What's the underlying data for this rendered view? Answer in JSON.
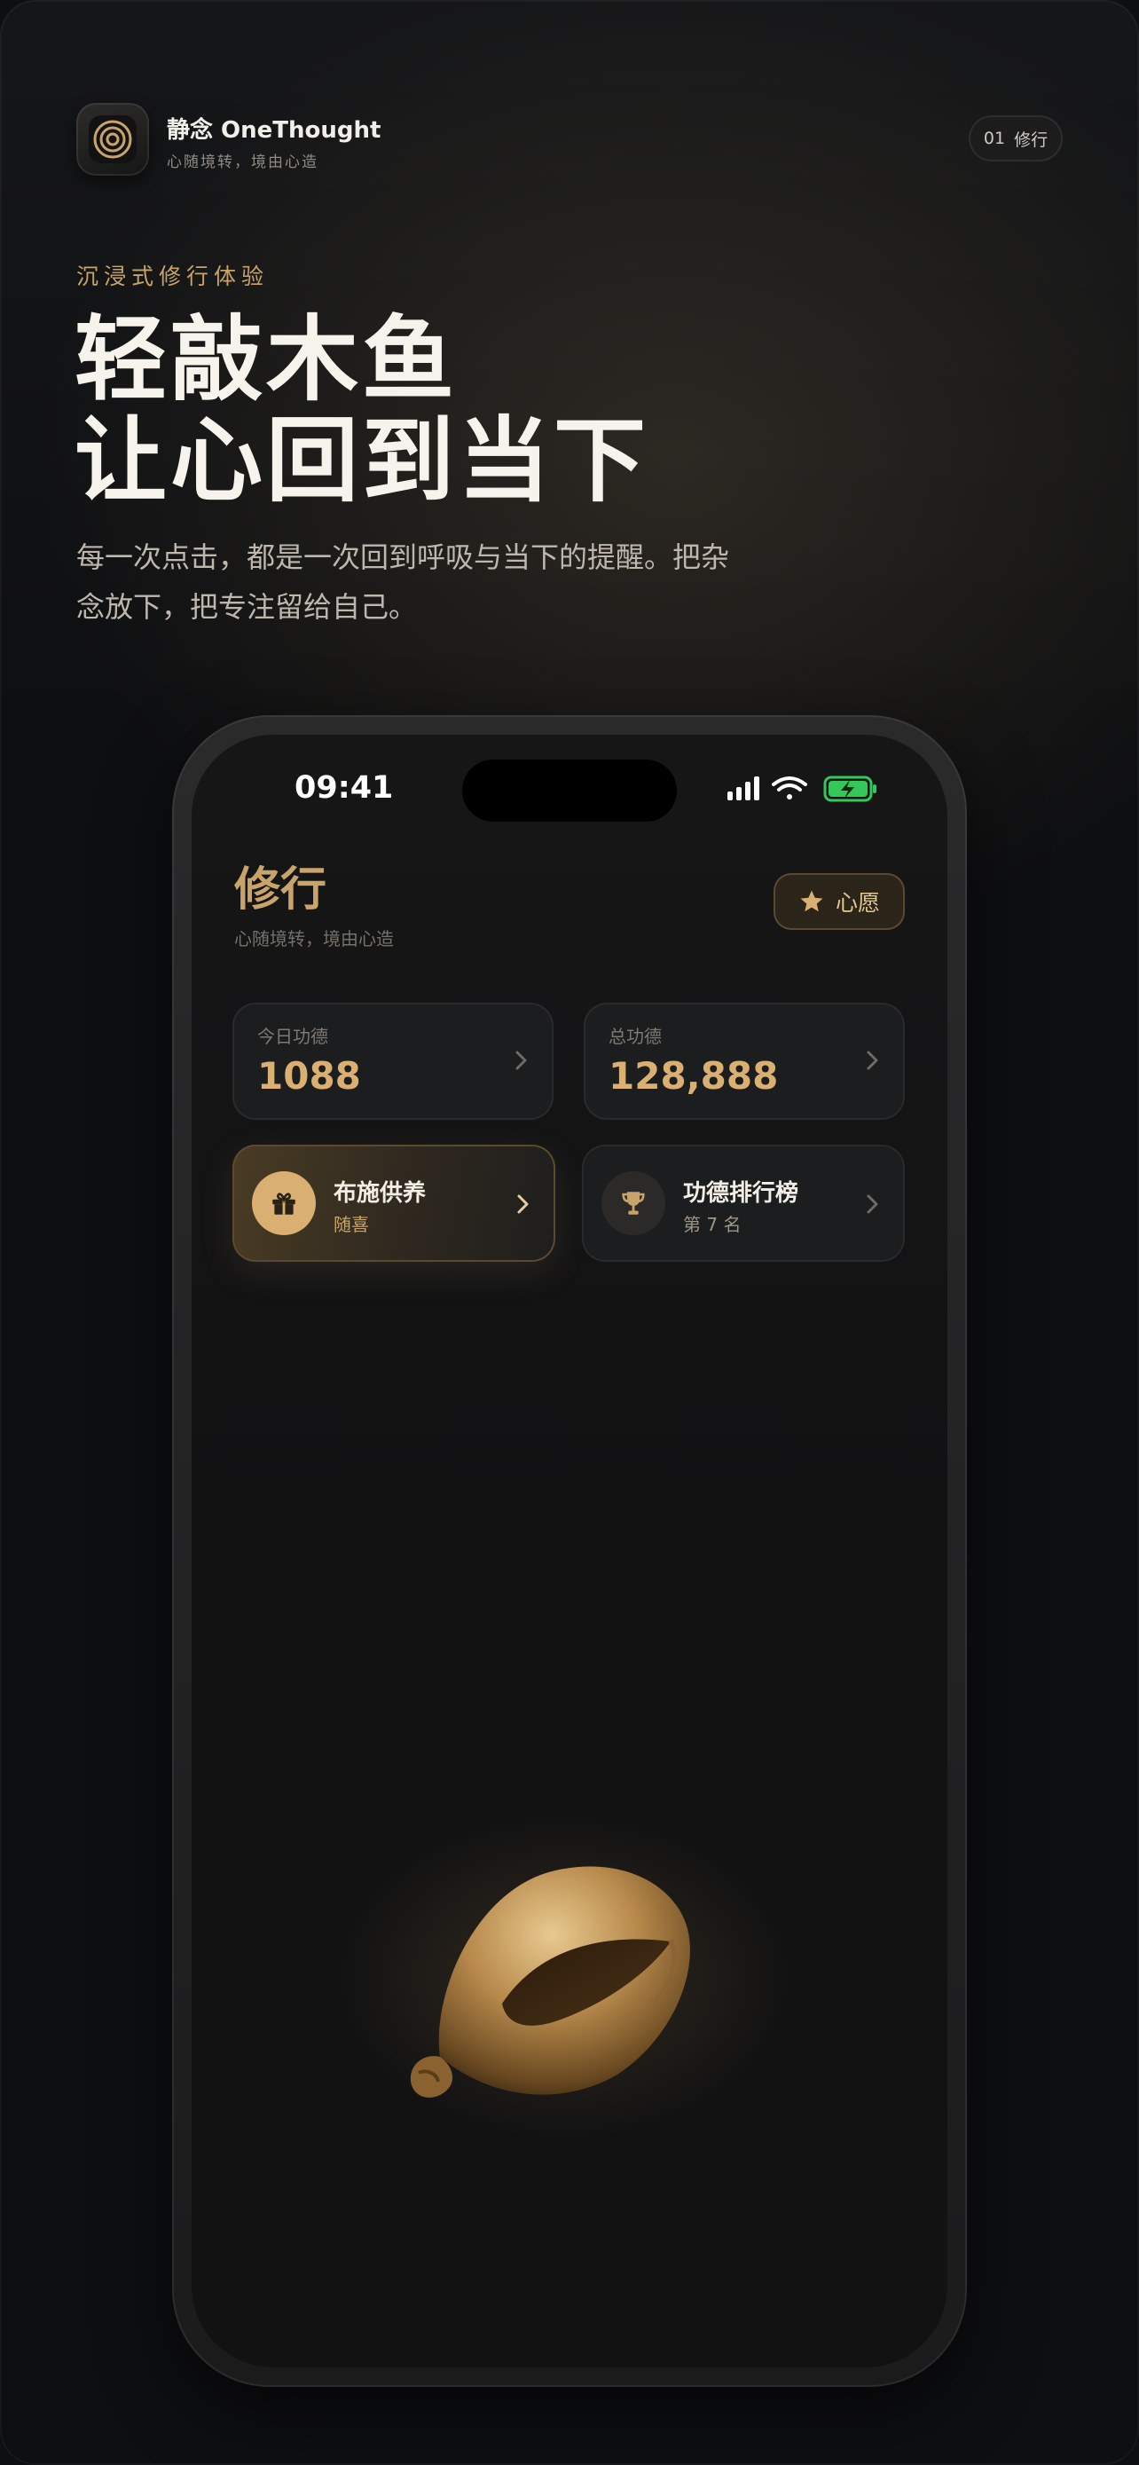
{
  "header": {
    "brand_name": "静念 OneThought",
    "brand_tagline": "心随境转，境由心造",
    "page_number": "01",
    "page_label": "修行"
  },
  "hero": {
    "eyebrow": "沉浸式修行体验",
    "title_line1": "轻敲木鱼",
    "title_line2": "让心回到当下",
    "description": "每一次点击，都是一次回到呼吸与当下的提醒。把杂念放下，把专注留给自己。"
  },
  "phone": {
    "status_time": "09:41",
    "screen_title": "修行",
    "screen_subtitle": "心随境转，境由心造",
    "wish_button_label": "心愿",
    "stats": [
      {
        "label": "今日功德",
        "value": "1088"
      },
      {
        "label": "总功德",
        "value": "128,888"
      }
    ],
    "actions": [
      {
        "title": "布施供养",
        "subtitle": "随喜",
        "icon": "gift-icon"
      },
      {
        "title": "功德排行榜",
        "subtitle": "第 7 名",
        "icon": "trophy-icon"
      }
    ]
  },
  "colors": {
    "accent_gold": "#c9a46a",
    "background": "#0e0f11",
    "battery_green": "#34c759"
  }
}
